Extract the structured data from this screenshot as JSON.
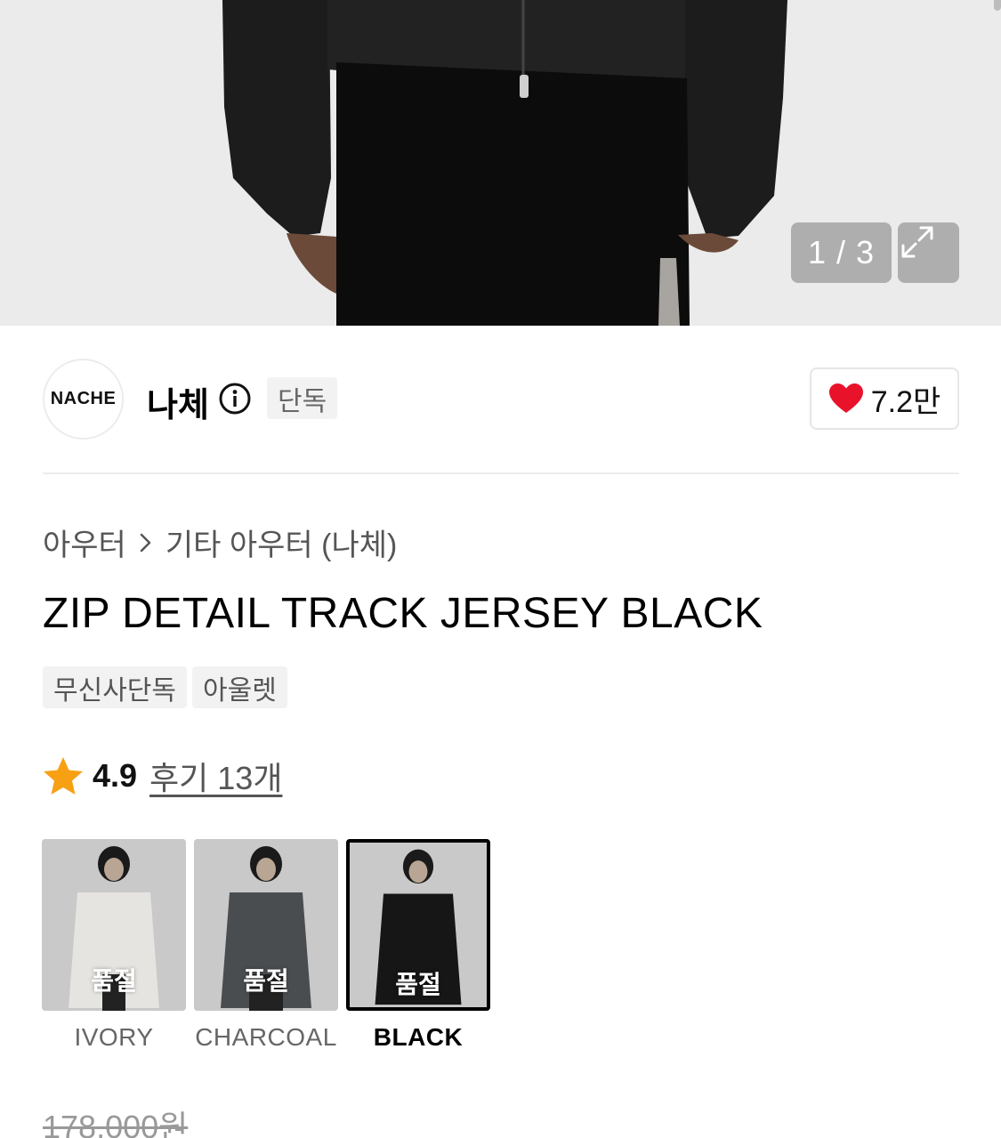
{
  "gallery": {
    "counter": "1 / 3",
    "expand_icon": "expand-icon"
  },
  "brand": {
    "logo_text": "NACHE",
    "name": "나체",
    "info_icon": "info-icon",
    "exclusive_badge": "단독",
    "like_icon": "heart-icon",
    "like_color": "#e8132b",
    "like_count": "7.2만"
  },
  "breadcrumb": {
    "category": "아우터",
    "separator_icon": "chevron-right-icon",
    "subcategory": "기타 아우터 (나체)"
  },
  "product": {
    "title": "ZIP DETAIL TRACK JERSEY BLACK",
    "tags": [
      "무신사단독",
      "아울렛"
    ]
  },
  "rating": {
    "star_icon": "star-icon",
    "star_color": "#f7a014",
    "score": "4.9",
    "reviews": "후기 13개"
  },
  "colors": [
    {
      "label": "IVORY",
      "status": "품절",
      "garment": "#e6e4e0",
      "selected": false
    },
    {
      "label": "CHARCOAL",
      "status": "품절",
      "garment": "#4a4d50",
      "selected": false
    },
    {
      "label": "BLACK",
      "status": "품절",
      "garment": "#161616",
      "selected": true
    }
  ],
  "price": {
    "original": "178,000원"
  }
}
